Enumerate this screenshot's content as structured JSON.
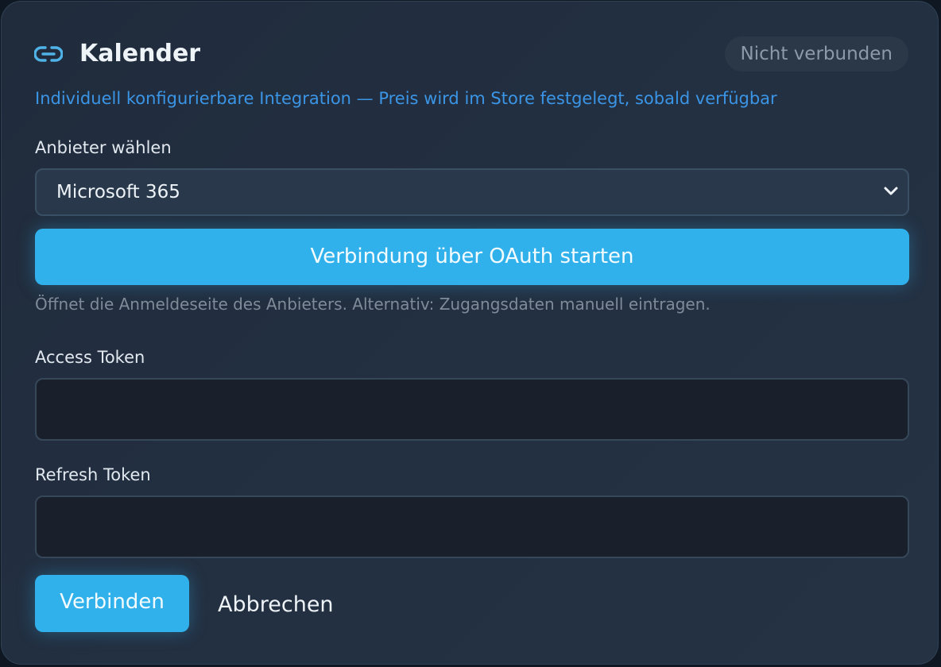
{
  "header": {
    "icon": "link-icon",
    "title": "Kalender",
    "status": "Nicht verbunden"
  },
  "subtitle": "Individuell konfigurierbare Integration — Preis wird im Store festgelegt, sobald verfügbar",
  "provider": {
    "label": "Anbieter wählen",
    "selected": "Microsoft 365",
    "icon": "chevron-down-icon"
  },
  "oauth": {
    "button_label": "Verbindung über OAuth starten",
    "hint": "Öffnet die Anmeldeseite des Anbieters. Alternativ: Zugangsdaten manuell eintragen."
  },
  "access_token": {
    "label": "Access Token",
    "value": ""
  },
  "refresh_token": {
    "label": "Refresh Token",
    "value": ""
  },
  "actions": {
    "connect_label": "Verbinden",
    "cancel_label": "Abbrechen"
  },
  "colors": {
    "accent": "#30b1eb",
    "link": "#3b95e6",
    "card_background": "#222f40",
    "input_background": "#1a202b"
  }
}
